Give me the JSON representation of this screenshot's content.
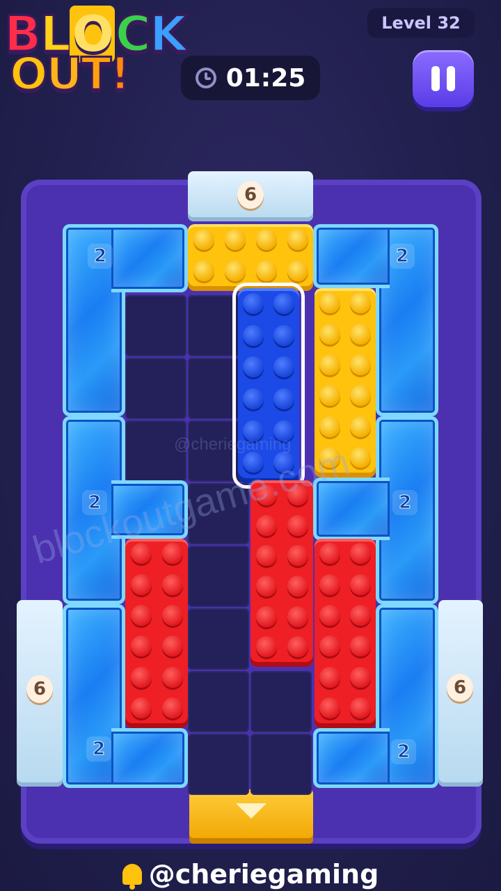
{
  "logo": {
    "line1": "BLOCK",
    "line2": "OUT!"
  },
  "header": {
    "level": "Level 32",
    "timer": "01:25"
  },
  "board": {
    "ice_counts": {
      "top_left": "2",
      "top_right": "2",
      "mid_left": "2",
      "mid_right": "2",
      "bottom_left": "2",
      "bottom_right": "2"
    },
    "gates": {
      "top": "6",
      "left": "6",
      "right": "6"
    }
  },
  "watermark": {
    "main": "blockoutgame.com",
    "small": "@cheriegaming"
  },
  "footer": {
    "handle": "@cheriegaming"
  },
  "colors": {
    "yellow": "#ffc20d",
    "blue": "#1b4ae6",
    "red": "#ee1f25",
    "board": "#4b31b0",
    "ice": "#1a7ef2"
  }
}
